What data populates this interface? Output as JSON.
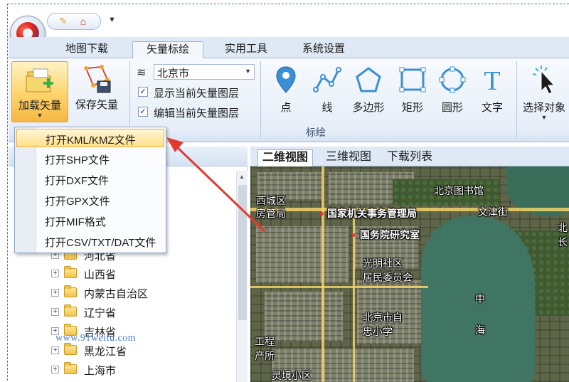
{
  "colors": {
    "accent": "#3e78c6",
    "highlight": "#ffd36b",
    "arrow": "#e23a2e"
  },
  "tabs": [
    {
      "label": "地图下载"
    },
    {
      "label": "矢量标绘"
    },
    {
      "label": "实用工具"
    },
    {
      "label": "系统设置"
    }
  ],
  "active_tab": "矢量标绘",
  "ribbon": {
    "load_vector": "加载矢量",
    "save_vector": "保存矢量",
    "city_select": "北京市",
    "show_layer": "显示当前矢量图层",
    "edit_layer": "编辑当前矢量图层",
    "tools": [
      {
        "label": "点",
        "icon": "point-icon"
      },
      {
        "label": "线",
        "icon": "polyline-icon"
      },
      {
        "label": "多边形",
        "icon": "polygon-icon"
      },
      {
        "label": "矩形",
        "icon": "rectangle-icon"
      },
      {
        "label": "圆形",
        "icon": "circle-icon"
      },
      {
        "label": "文字",
        "icon": "text-icon"
      },
      {
        "label": "选择对象",
        "icon": "select-cursor-icon"
      }
    ],
    "group_label": "标绘"
  },
  "dropdown": [
    {
      "label": "打开KML/KMZ文件"
    },
    {
      "label": "打开SHP文件"
    },
    {
      "label": "打开DXF文件"
    },
    {
      "label": "打开GPX文件"
    },
    {
      "label": "打开MIF格式"
    },
    {
      "label": "打开CSV/TXT/DAT文件"
    }
  ],
  "tree": [
    {
      "label": "河北省"
    },
    {
      "label": "山西省"
    },
    {
      "label": "内蒙古自治区"
    },
    {
      "label": "辽宁省"
    },
    {
      "label": "吉林省"
    },
    {
      "label": "黑龙江省"
    },
    {
      "label": "上海市"
    }
  ],
  "watermark": "www.91weitu.com",
  "map_tabs": [
    {
      "label": "二维视图"
    },
    {
      "label": "三维视图"
    },
    {
      "label": "下载列表"
    }
  ],
  "map_labels": {
    "xicheng_1": "西城区",
    "xicheng_2": "房管局",
    "library": "北京图书馆",
    "admin_bureau": "国家机关事务管理局",
    "wenjin": "文津街",
    "research": "国务院研究室",
    "guangming_1": "光明社区",
    "guangming_2": "居民委员会",
    "school_1": "北京市自",
    "school_2": "忠小学",
    "zhong": "中",
    "hai": "海",
    "gongcheng_1": "工程",
    "gongcheng_2": "产所",
    "lingjing": "灵境小区",
    "edge_bei": "北",
    "edge_chang": "长"
  }
}
